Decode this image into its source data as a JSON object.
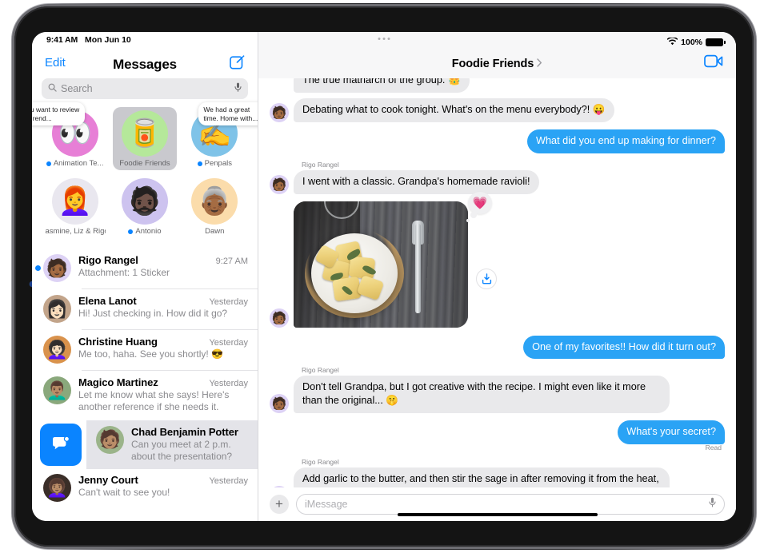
{
  "status_bar": {
    "time": "9:41 AM",
    "date": "Mon Jun 10",
    "battery_percent": "100%",
    "wifi_icon": "wifi-icon",
    "battery_icon": "battery-icon"
  },
  "sidebar": {
    "edit_label": "Edit",
    "title": "Messages",
    "compose_icon": "compose-icon",
    "search": {
      "placeholder": "Search",
      "search_icon": "search-icon",
      "mic_icon": "microphone-icon"
    },
    "pinned": [
      {
        "name": "Animation Te...",
        "emoji": "👀",
        "bg": "#e77fd6",
        "has_unread_dot": true,
        "preview": "Do you want to review all the rend...",
        "preview_side": "left",
        "selected": false
      },
      {
        "name": "Foodie Friends",
        "emoji": "🥫",
        "bg": "#b5e89a",
        "has_unread_dot": false,
        "preview": "",
        "preview_side": "",
        "selected": true
      },
      {
        "name": "Penpals",
        "emoji": "✍️",
        "bg": "#7fc3e8",
        "has_unread_dot": true,
        "preview": "We had a great time. Home with...",
        "preview_side": "right",
        "selected": false
      },
      {
        "name": "Jasmine, Liz & Rigo",
        "emoji": "👩‍🦰",
        "bg": "#e9e7ef",
        "has_unread_dot": false,
        "preview": "",
        "preview_side": "",
        "selected": false
      },
      {
        "name": "Antonio",
        "emoji": "🧔🏿",
        "bg": "#cdc3ef",
        "has_unread_dot": true,
        "preview": "",
        "preview_side": "",
        "selected": false
      },
      {
        "name": "Dawn",
        "emoji": "👵🏾",
        "bg": "#fbdcab",
        "has_unread_dot": false,
        "preview": "",
        "preview_side": "",
        "selected": false
      }
    ],
    "conversations": [
      {
        "name": "Rigo Rangel",
        "time": "9:27 AM",
        "snippet": "Attachment: 1 Sticker",
        "unread": true,
        "avatar_emoji": "🧑🏾",
        "avatar_bg": "#ddd2f5"
      },
      {
        "name": "Elena Lanot",
        "time": "Yesterday",
        "snippet": "Hi! Just checking in. How did it go?",
        "unread": false,
        "avatar_emoji": "👩🏻",
        "avatar_bg": "#c2a48a"
      },
      {
        "name": "Christine Huang",
        "time": "Yesterday",
        "snippet": "Me too, haha. See you shortly! 😎",
        "unread": false,
        "avatar_emoji": "👩🏻‍🦱",
        "avatar_bg": "#d9924c"
      },
      {
        "name": "Magico Martinez",
        "time": "Yesterday",
        "snippet": "Let me know what she says! Here's another reference if she needs it.",
        "unread": false,
        "avatar_emoji": "👨🏽‍🦱",
        "avatar_bg": "#8aa87c"
      }
    ],
    "swiped_row": {
      "name": "Chad Benjamin Potter",
      "snippet": "Can you meet at 2 p.m. about the presentation?",
      "action_icon": "mark-as-unread-icon",
      "action_color": "#0a84ff",
      "avatar_emoji": "🧑🏽",
      "avatar_bg": "#9bb48a"
    },
    "last_conversation": {
      "name": "Jenny Court",
      "time": "Yesterday",
      "snippet": "Can't wait to see you!",
      "unread": false,
      "avatar_emoji": "👩🏽‍🦱",
      "avatar_bg": "#3a2e28"
    }
  },
  "conversation": {
    "title": "Foodie Friends",
    "chevron_icon": "chevron-right-icon",
    "facetime_icon": "facetime-video-icon",
    "clipped_message": "The true matriarch of the group. 👑",
    "messages": [
      {
        "id": "m1",
        "direction": "in",
        "sender": "",
        "show_sender": false,
        "text": "Debating what to cook tonight. What's on the menu everybody?! 😛",
        "avatar_emoji": "🧑🏾",
        "avatar_bg": "#ddd2f5"
      },
      {
        "id": "m2",
        "direction": "out",
        "sender": "",
        "show_sender": false,
        "text": "What did you end up making for dinner?",
        "avatar_emoji": "",
        "avatar_bg": ""
      },
      {
        "id": "m3",
        "direction": "in",
        "sender": "Rigo Rangel",
        "show_sender": true,
        "text": "I went with a classic. Grandpa's homemade ravioli!",
        "avatar_emoji": "🧑🏾",
        "avatar_bg": "#ddd2f5"
      },
      {
        "id": "m4",
        "direction": "in",
        "type": "photo",
        "sender": "",
        "show_sender": false,
        "text": "",
        "photo_description": "Plate of ravioli with sage on a rustic wooden table",
        "tapback": "💗",
        "save_icon": "save-to-photos-icon",
        "avatar_emoji": "🧑🏾",
        "avatar_bg": "#ddd2f5"
      },
      {
        "id": "m5",
        "direction": "out",
        "sender": "",
        "show_sender": false,
        "text": "One of my favorites!! How did it turn out?",
        "avatar_emoji": "",
        "avatar_bg": ""
      },
      {
        "id": "m6",
        "direction": "in",
        "sender": "Rigo Rangel",
        "show_sender": true,
        "text": "Don't tell Grandpa, but I got creative with the recipe. I might even like it more than the original... 🤫",
        "avatar_emoji": "🧑🏾",
        "avatar_bg": "#ddd2f5"
      },
      {
        "id": "m7",
        "direction": "out",
        "sender": "",
        "show_sender": false,
        "text": "What's your secret?",
        "read_receipt": "Read",
        "avatar_emoji": "",
        "avatar_bg": ""
      },
      {
        "id": "m8",
        "direction": "in",
        "sender": "Rigo Rangel",
        "show_sender": true,
        "text": "Add garlic to the butter, and then stir the sage in after removing it from the heat, while it's still hot. Top with pine nuts!",
        "avatar_emoji": "🧑🏾",
        "avatar_bg": "#ddd2f5"
      }
    ],
    "read_receipt_label": "Read",
    "composer": {
      "plus_icon": "add-attachment-icon",
      "placeholder": "iMessage",
      "mic_icon": "microphone-icon"
    }
  },
  "colors": {
    "accent_blue": "#0a84ff",
    "bubble_out": "#2aa3f5",
    "bubble_in": "#e9e9eb",
    "secondary_text": "#8a8a8e"
  }
}
